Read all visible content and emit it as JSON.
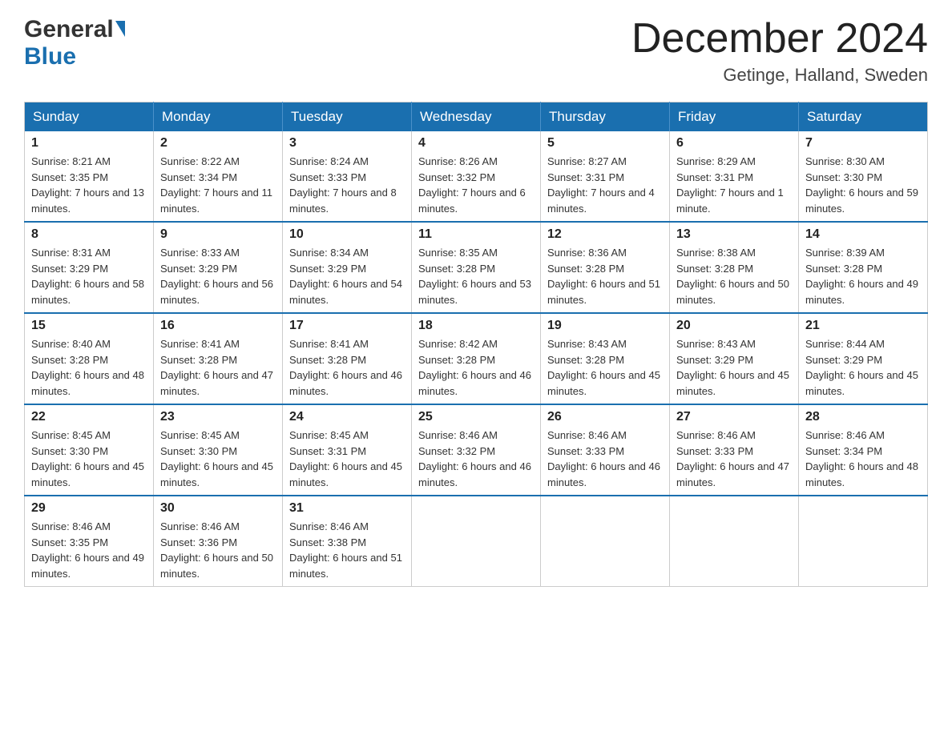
{
  "header": {
    "logo_general": "General",
    "logo_blue": "Blue",
    "month_title": "December 2024",
    "location": "Getinge, Halland, Sweden"
  },
  "weekdays": [
    "Sunday",
    "Monday",
    "Tuesday",
    "Wednesday",
    "Thursday",
    "Friday",
    "Saturday"
  ],
  "weeks": [
    [
      {
        "day": "1",
        "sunrise": "8:21 AM",
        "sunset": "3:35 PM",
        "daylight": "7 hours and 13 minutes."
      },
      {
        "day": "2",
        "sunrise": "8:22 AM",
        "sunset": "3:34 PM",
        "daylight": "7 hours and 11 minutes."
      },
      {
        "day": "3",
        "sunrise": "8:24 AM",
        "sunset": "3:33 PM",
        "daylight": "7 hours and 8 minutes."
      },
      {
        "day": "4",
        "sunrise": "8:26 AM",
        "sunset": "3:32 PM",
        "daylight": "7 hours and 6 minutes."
      },
      {
        "day": "5",
        "sunrise": "8:27 AM",
        "sunset": "3:31 PM",
        "daylight": "7 hours and 4 minutes."
      },
      {
        "day": "6",
        "sunrise": "8:29 AM",
        "sunset": "3:31 PM",
        "daylight": "7 hours and 1 minute."
      },
      {
        "day": "7",
        "sunrise": "8:30 AM",
        "sunset": "3:30 PM",
        "daylight": "6 hours and 59 minutes."
      }
    ],
    [
      {
        "day": "8",
        "sunrise": "8:31 AM",
        "sunset": "3:29 PM",
        "daylight": "6 hours and 58 minutes."
      },
      {
        "day": "9",
        "sunrise": "8:33 AM",
        "sunset": "3:29 PM",
        "daylight": "6 hours and 56 minutes."
      },
      {
        "day": "10",
        "sunrise": "8:34 AM",
        "sunset": "3:29 PM",
        "daylight": "6 hours and 54 minutes."
      },
      {
        "day": "11",
        "sunrise": "8:35 AM",
        "sunset": "3:28 PM",
        "daylight": "6 hours and 53 minutes."
      },
      {
        "day": "12",
        "sunrise": "8:36 AM",
        "sunset": "3:28 PM",
        "daylight": "6 hours and 51 minutes."
      },
      {
        "day": "13",
        "sunrise": "8:38 AM",
        "sunset": "3:28 PM",
        "daylight": "6 hours and 50 minutes."
      },
      {
        "day": "14",
        "sunrise": "8:39 AM",
        "sunset": "3:28 PM",
        "daylight": "6 hours and 49 minutes."
      }
    ],
    [
      {
        "day": "15",
        "sunrise": "8:40 AM",
        "sunset": "3:28 PM",
        "daylight": "6 hours and 48 minutes."
      },
      {
        "day": "16",
        "sunrise": "8:41 AM",
        "sunset": "3:28 PM",
        "daylight": "6 hours and 47 minutes."
      },
      {
        "day": "17",
        "sunrise": "8:41 AM",
        "sunset": "3:28 PM",
        "daylight": "6 hours and 46 minutes."
      },
      {
        "day": "18",
        "sunrise": "8:42 AM",
        "sunset": "3:28 PM",
        "daylight": "6 hours and 46 minutes."
      },
      {
        "day": "19",
        "sunrise": "8:43 AM",
        "sunset": "3:28 PM",
        "daylight": "6 hours and 45 minutes."
      },
      {
        "day": "20",
        "sunrise": "8:43 AM",
        "sunset": "3:29 PM",
        "daylight": "6 hours and 45 minutes."
      },
      {
        "day": "21",
        "sunrise": "8:44 AM",
        "sunset": "3:29 PM",
        "daylight": "6 hours and 45 minutes."
      }
    ],
    [
      {
        "day": "22",
        "sunrise": "8:45 AM",
        "sunset": "3:30 PM",
        "daylight": "6 hours and 45 minutes."
      },
      {
        "day": "23",
        "sunrise": "8:45 AM",
        "sunset": "3:30 PM",
        "daylight": "6 hours and 45 minutes."
      },
      {
        "day": "24",
        "sunrise": "8:45 AM",
        "sunset": "3:31 PM",
        "daylight": "6 hours and 45 minutes."
      },
      {
        "day": "25",
        "sunrise": "8:46 AM",
        "sunset": "3:32 PM",
        "daylight": "6 hours and 46 minutes."
      },
      {
        "day": "26",
        "sunrise": "8:46 AM",
        "sunset": "3:33 PM",
        "daylight": "6 hours and 46 minutes."
      },
      {
        "day": "27",
        "sunrise": "8:46 AM",
        "sunset": "3:33 PM",
        "daylight": "6 hours and 47 minutes."
      },
      {
        "day": "28",
        "sunrise": "8:46 AM",
        "sunset": "3:34 PM",
        "daylight": "6 hours and 48 minutes."
      }
    ],
    [
      {
        "day": "29",
        "sunrise": "8:46 AM",
        "sunset": "3:35 PM",
        "daylight": "6 hours and 49 minutes."
      },
      {
        "day": "30",
        "sunrise": "8:46 AM",
        "sunset": "3:36 PM",
        "daylight": "6 hours and 50 minutes."
      },
      {
        "day": "31",
        "sunrise": "8:46 AM",
        "sunset": "3:38 PM",
        "daylight": "6 hours and 51 minutes."
      },
      null,
      null,
      null,
      null
    ]
  ]
}
